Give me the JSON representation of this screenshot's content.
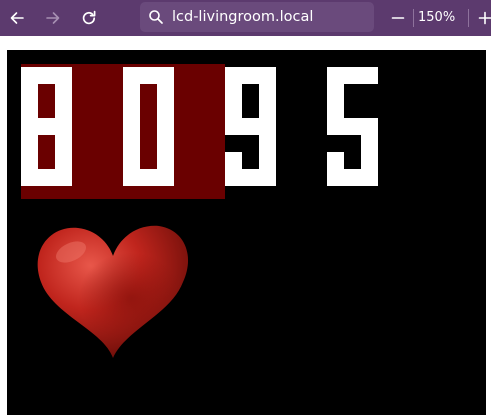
{
  "browser": {
    "back_icon": "arrow-left-icon",
    "forward_icon": "arrow-right-icon",
    "reload_icon": "reload-icon",
    "search_icon": "search-icon",
    "url": "lcd-livingroom.local",
    "zoom_out_label": "—",
    "zoom_level": "150%",
    "zoom_in_label": "+",
    "toolbar_color": "#5c3a6e"
  },
  "lcd": {
    "digits": [
      "8",
      "0",
      "9",
      "5"
    ],
    "highlighted_digits": 2,
    "highlight_color": "#6a0000",
    "background_color": "#000000",
    "foreground_color": "#ffffff",
    "icon": "heart-icon",
    "icon_color": "#c0251d"
  }
}
